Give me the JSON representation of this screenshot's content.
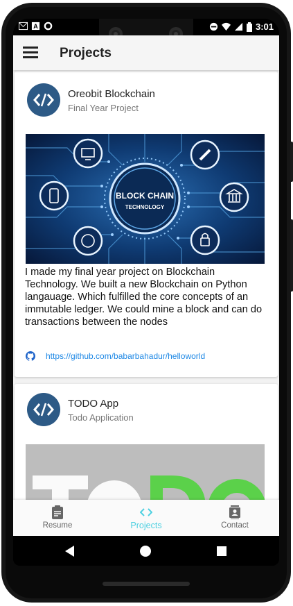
{
  "status_bar": {
    "time": "3:01"
  },
  "app_bar": {
    "title": "Projects"
  },
  "cards": [
    {
      "title": "Oreobit Blockchain",
      "subtitle": "Final Year Project",
      "image_text": {
        "line1": "BLOCK CHAIN",
        "line2": "TECHNOLOGY"
      },
      "description": "I made my final year project on Blockchain Technology. We built a new Blockchain on Python langauage. Which fulfilled the core concepts of an immutable ledger. We could mine a block and can do transactions between the nodes",
      "link": "https://github.com/babarbahadur/helloworld"
    },
    {
      "title": "TODO App",
      "subtitle": "Todo Application"
    }
  ],
  "bottom_nav": [
    {
      "label": "Resume",
      "active": false
    },
    {
      "label": "Projects",
      "active": true
    },
    {
      "label": "Contact",
      "active": false
    }
  ],
  "colors": {
    "accent": "#4dd0e1",
    "avatar": "#2d5a86",
    "link": "#1e88e5",
    "inactive": "#666666"
  }
}
